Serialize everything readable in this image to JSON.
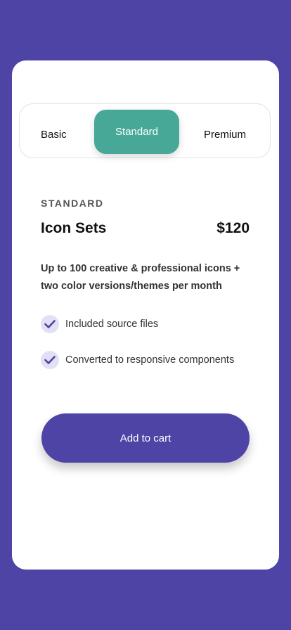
{
  "colors": {
    "background": "#4e44a5",
    "card": "#ffffff",
    "active_tab": "#47a898",
    "button": "#4e44a5",
    "check_bg": "#e2e0f4",
    "check_mark": "#4e44a5"
  },
  "tabs": [
    {
      "label": "Basic",
      "active": false
    },
    {
      "label": "Standard",
      "active": true
    },
    {
      "label": "Premium",
      "active": false
    }
  ],
  "plan": {
    "label": "STANDARD",
    "name": "Icon Sets",
    "price": "$120",
    "description": "Up to 100 creative & professional  icons + two color versions/themes per month"
  },
  "features": [
    {
      "icon": "check-icon",
      "text": "Included  source files"
    },
    {
      "icon": "check-icon",
      "text": "Converted to responsive components"
    }
  ],
  "cart_button": {
    "label": "Add to cart"
  }
}
